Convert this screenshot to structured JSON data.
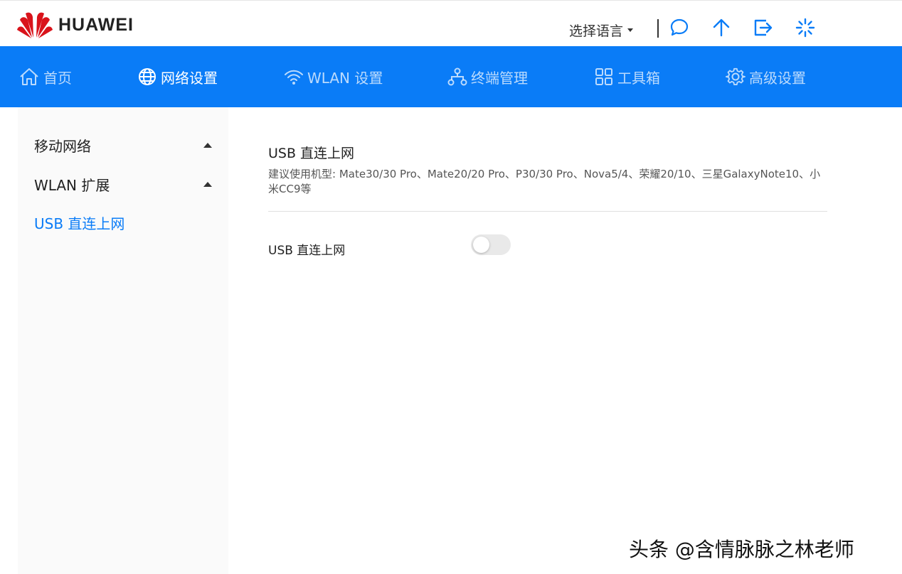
{
  "brand": {
    "name": "HUAWEI",
    "color": "#d9131b"
  },
  "header": {
    "language_label": "选择语言",
    "icons": [
      "message-icon",
      "upload-icon",
      "logout-icon",
      "loading-icon"
    ]
  },
  "nav": {
    "accent": "#0a7cf7",
    "items": [
      {
        "label": "首页",
        "icon": "home-icon"
      },
      {
        "label": "网络设置",
        "icon": "globe-icon",
        "active": true
      },
      {
        "label": "WLAN 设置",
        "icon": "wifi-icon"
      },
      {
        "label": "终端管理",
        "icon": "devices-icon"
      },
      {
        "label": "工具箱",
        "icon": "toolbox-icon"
      },
      {
        "label": "高级设置",
        "icon": "gear-icon"
      }
    ]
  },
  "sidebar": {
    "items": [
      {
        "label": "移动网络",
        "expandable": true
      },
      {
        "label": "WLAN 扩展",
        "expandable": true
      },
      {
        "label": "USB 直连上网",
        "selected": true
      }
    ]
  },
  "main": {
    "title": "USB 直连上网",
    "description": "建议使用机型: Mate30/30 Pro、Mate20/20 Pro、P30/30 Pro、Nova5/4、荣耀20/10、三星GalaxyNote10、小米CC9等",
    "setting": {
      "label": "USB 直连上网",
      "enabled": false
    }
  },
  "watermark": "头条 @含情脉脉之林老师"
}
